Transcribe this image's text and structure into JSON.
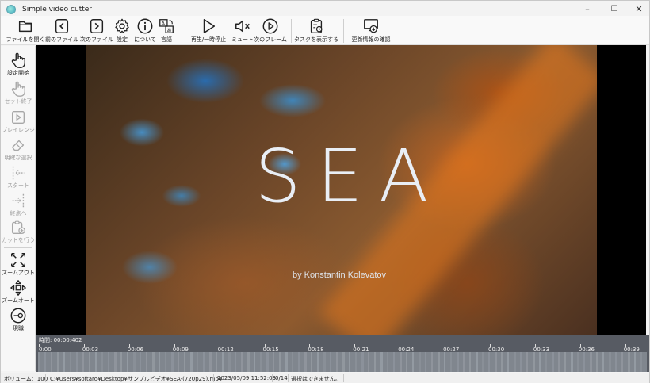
{
  "window": {
    "title": "Simple video cutter",
    "controls": {
      "minimize": "–",
      "maximize": "☐",
      "close": "✕"
    }
  },
  "toolbar": {
    "items": [
      {
        "label": "ファイルを開く",
        "icon": "folder-open-icon"
      },
      {
        "label": "前のファイル",
        "icon": "previous-file-icon"
      },
      {
        "label": "次のファイル",
        "icon": "next-file-icon"
      },
      {
        "label": "設定",
        "icon": "gear-icon"
      },
      {
        "label": "について",
        "icon": "info-icon"
      },
      {
        "label": "言語",
        "icon": "language-icon"
      },
      {
        "label": "再生/一時停止",
        "icon": "play-icon"
      },
      {
        "label": "ミュート",
        "icon": "mute-icon"
      },
      {
        "label": "次のフレーム",
        "icon": "next-frame-icon"
      },
      {
        "label": "タスクを表示する",
        "icon": "task-list-icon"
      },
      {
        "label": "更新情報の確認",
        "icon": "update-check-icon"
      }
    ]
  },
  "sidebar": {
    "items": [
      {
        "label": "設定開始",
        "icon": "pointer-hand-icon",
        "enabled": true
      },
      {
        "label": "セット終了",
        "icon": "pointer-hand-icon",
        "enabled": false
      },
      {
        "label": "プレイレンジ",
        "icon": "play-range-icon",
        "enabled": false
      },
      {
        "label": "明確な選択",
        "icon": "eraser-icon",
        "enabled": false
      },
      {
        "label": "スタート",
        "icon": "go-start-icon",
        "enabled": false
      },
      {
        "label": "終点へ",
        "icon": "go-end-icon",
        "enabled": false
      },
      {
        "label": "カットを行う",
        "icon": "add-cut-icon",
        "enabled": false
      },
      {
        "label": "ズームアウト",
        "icon": "zoom-out-icon",
        "enabled": true
      },
      {
        "label": "ズームオート",
        "icon": "zoom-auto-icon",
        "enabled": true
      },
      {
        "label": "現職",
        "icon": "current-position-icon",
        "enabled": true
      }
    ]
  },
  "video": {
    "title_text": "SEA",
    "credit_text": "by Konstantin Kolevatov"
  },
  "timeline": {
    "time_label": "時間: 00:00:402",
    "ticks": [
      "0:00",
      "00:03",
      "00:06",
      "00:09",
      "00:12",
      "00:15",
      "00:18",
      "00:21",
      "00:24",
      "00:27",
      "00:30",
      "00:33",
      "00:36",
      "00:39"
    ]
  },
  "status": {
    "volume": "ボリューム：100",
    "file_path": "C:¥Users¥softaro¥Desktop¥サンプルビデオ¥SEA-(720p29).mp4",
    "modified": "2023/05/09 11:52:03",
    "count": "0/14",
    "message": "選択はできません。"
  }
}
